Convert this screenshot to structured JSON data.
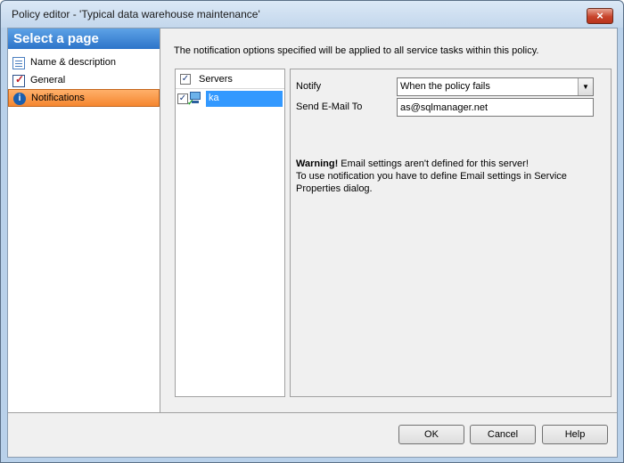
{
  "window": {
    "title": "Policy editor - 'Typical data warehouse maintenance'",
    "close_glyph": "×"
  },
  "sidebar": {
    "header": "Select a page",
    "items": [
      {
        "label": "Name & description",
        "icon": "document-icon"
      },
      {
        "label": "General",
        "icon": "checklist-icon"
      },
      {
        "label": "Notifications",
        "icon": "info-icon",
        "selected": true
      }
    ]
  },
  "main": {
    "info_text": "The notification options specified will be applied to all service tasks within this policy.",
    "servers": {
      "header": "Servers",
      "header_checked": true,
      "rows": [
        {
          "name": "ka",
          "checked": true,
          "icon": "computer-icon"
        }
      ]
    },
    "notify": {
      "label": "Notify",
      "value": "When the policy fails"
    },
    "email": {
      "label": "Send E-Mail To",
      "value": "as@sqlmanager.net"
    },
    "warning": {
      "title": "Warning!",
      "line1": " Email settings aren't defined for this server!",
      "line2": "To use notification you have to define Email settings in Service Properties dialog."
    }
  },
  "footer": {
    "ok_label": "OK",
    "cancel_label": "Cancel",
    "help_label": "Help"
  },
  "colors": {
    "header_blue": "#2d74c9",
    "selected_orange": "#f5862f",
    "selection_blue": "#3399ff"
  }
}
